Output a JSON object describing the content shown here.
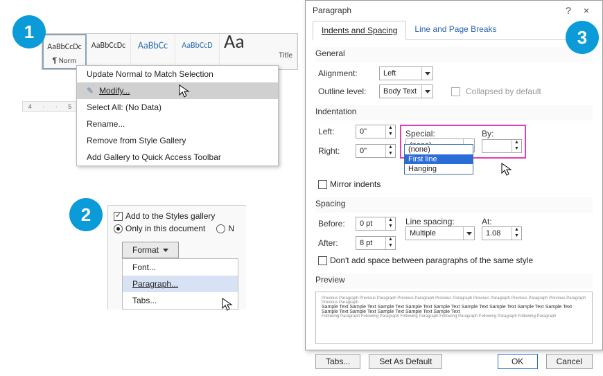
{
  "badges": {
    "one": "1",
    "two": "2",
    "three": "3"
  },
  "styles_gallery": {
    "swatches": [
      {
        "preview": "AaBbCcDc",
        "label": "¶ Norm"
      },
      {
        "preview": "AaBbCcDc",
        "label": ""
      },
      {
        "preview": "AaBbCc",
        "label": ""
      },
      {
        "preview": "AaBbCcD",
        "label": ""
      },
      {
        "preview": "Aa",
        "label": "Title"
      }
    ]
  },
  "context_menu": {
    "items": [
      "Update Normal to Match Selection",
      "Modify...",
      "Select All: (No Data)",
      "Rename...",
      "Remove from Style Gallery",
      "Add Gallery to Quick Access Toolbar"
    ],
    "selected_index": 1
  },
  "ruler": [
    "4",
    "·",
    "·",
    "5"
  ],
  "panel2": {
    "add_to_gallery": "Add to the Styles gallery",
    "only_in_doc": "Only in this document",
    "ne_radio": "N",
    "format_btn": "Format",
    "menu": [
      "Font...",
      "Paragraph...",
      "Tabs..."
    ],
    "menu_selected_index": 1
  },
  "dialog": {
    "title": "Paragraph",
    "help": "?",
    "close": "×",
    "tabs": [
      "Indents and Spacing",
      "Line and Page Breaks"
    ],
    "active_tab": 0,
    "general": {
      "hdr": "General",
      "alignment_lbl": "Alignment:",
      "alignment_val": "Left",
      "outline_lbl": "Outline level:",
      "outline_val": "Body Text",
      "collapsed_lbl": "Collapsed by default"
    },
    "indent": {
      "hdr": "Indentation",
      "left_lbl": "Left:",
      "left_val": "0\"",
      "right_lbl": "Right:",
      "right_val": "0\"",
      "special_lbl": "Special:",
      "special_val": "(none)",
      "special_options": [
        "(none)",
        "First line",
        "Hanging"
      ],
      "special_selected_index": 1,
      "by_lbl": "By:",
      "by_val": "",
      "mirror_lbl": "Mirror indents"
    },
    "spacing": {
      "hdr": "Spacing",
      "before_lbl": "Before:",
      "before_val": "0 pt",
      "after_lbl": "After:",
      "after_val": "8 pt",
      "line_lbl": "Line spacing:",
      "line_val": "Multiple",
      "at_lbl": "At:",
      "at_val": "1.08",
      "dont_add_lbl": "Don't add space between paragraphs of the same style"
    },
    "preview_hdr": "Preview",
    "preview_faded": "Previous Paragraph Previous Paragraph Previous Paragraph Previous Paragraph Previous Paragraph Previous Paragraph Previous Paragraph Previous Paragraph",
    "preview_sample": "Sample Text Sample Text Sample Text Sample Text Sample Text Sample Text Sample Text Sample Text Sample Text Sample Text Sample Text Sample Text Sample Text Sample Text",
    "preview_following": "Following Paragraph Following Paragraph Following Paragraph Following Paragraph Following Paragraph Following Paragraph",
    "buttons": {
      "tabs": "Tabs...",
      "default": "Set As Default",
      "ok": "OK",
      "cancel": "Cancel"
    }
  }
}
